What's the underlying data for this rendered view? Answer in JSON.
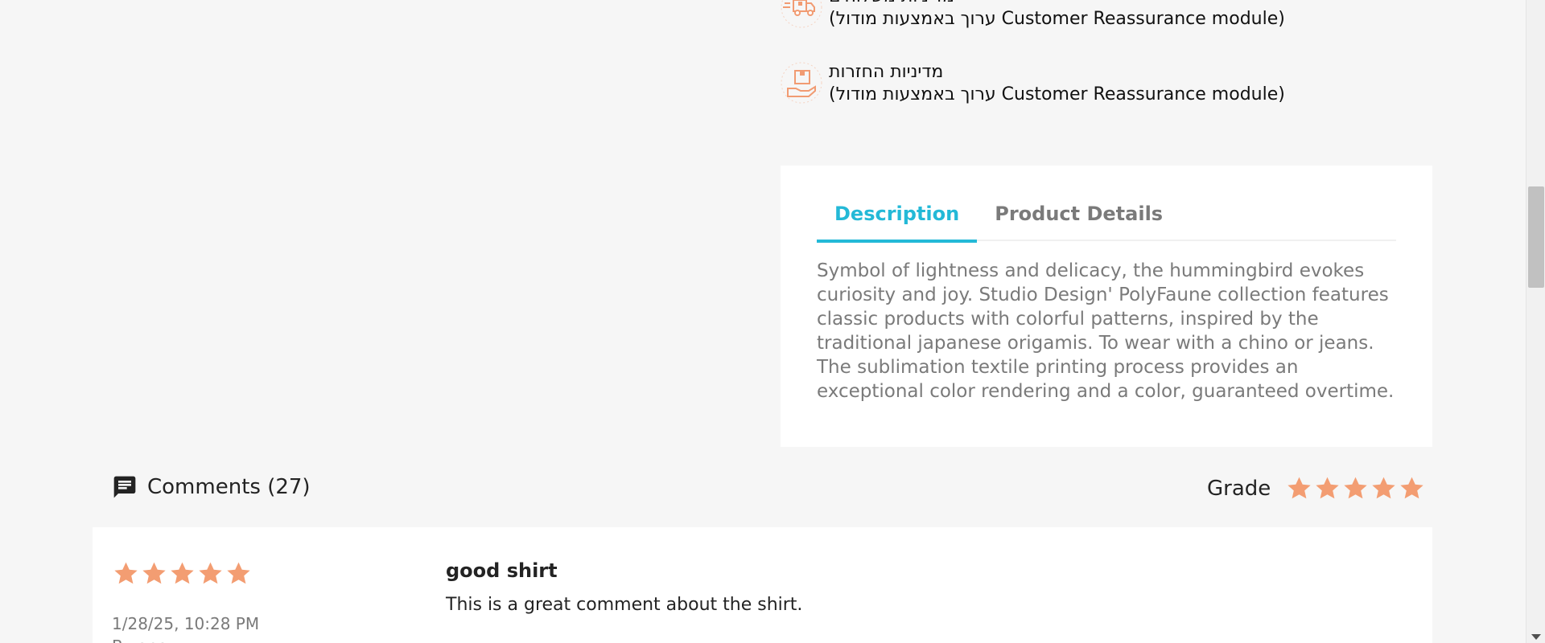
{
  "reassurance": [
    {
      "title": "מדיניות משלוחים",
      "body": "(ערוך באמצעות מודול Customer Reassurance module)",
      "icon": "delivery-truck-icon"
    },
    {
      "title": "מדיניות החזרות",
      "body": "(ערוך באמצעות מודול Customer Reassurance module)",
      "icon": "return-box-icon"
    }
  ],
  "tabs": {
    "items": [
      {
        "label": "Description"
      },
      {
        "label": "Product Details"
      }
    ],
    "active": "Description",
    "description": "Symbol of lightness and delicacy, the hummingbird evokes curiosity and joy. Studio Design' PolyFaune collection features classic products with colorful patterns, inspired by the traditional japanese origamis. To wear with a chino or jeans. The sublimation textile printing process provides an exceptional color rendering and a color, guaranteed overtime."
  },
  "comments": {
    "title": "Comments (27)",
    "grade_label": "Grade",
    "grade_value": 5,
    "grade_max": 5
  },
  "review": {
    "rating": 5,
    "rating_max": 5,
    "date": "1/28/25, 10:28 PM",
    "author_line": "By ano…",
    "title": "good shirt",
    "body": "This is a great comment about the shirt."
  },
  "colors": {
    "accent": "#24b9d7",
    "star": "#f39d72",
    "icon": "#f19b72"
  }
}
